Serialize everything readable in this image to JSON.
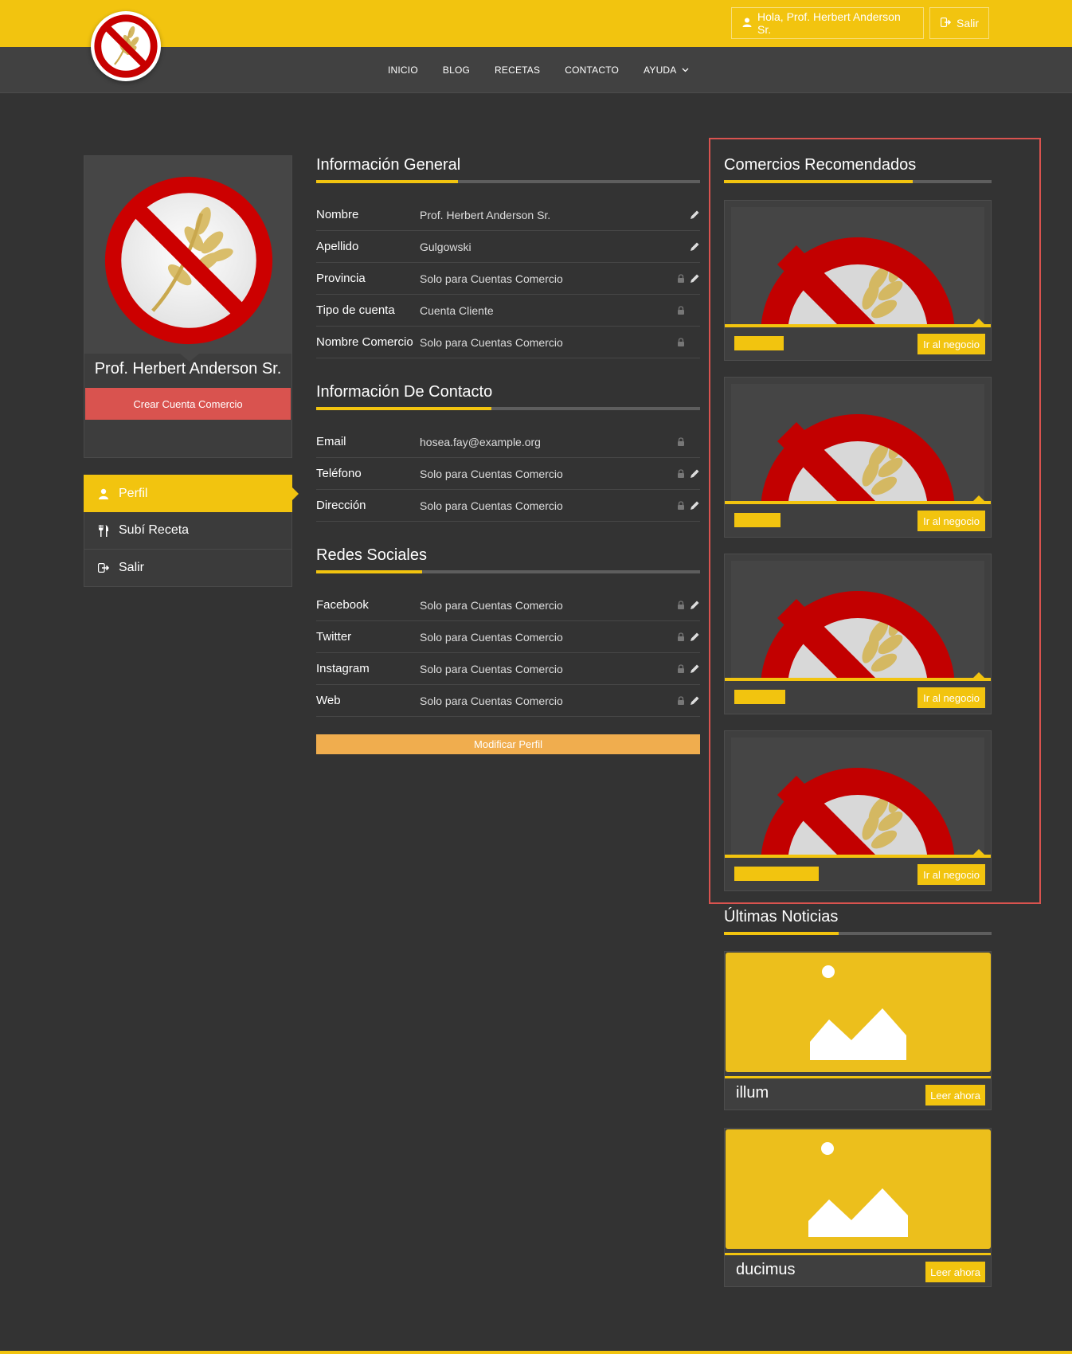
{
  "header": {
    "greeting": "Hola, Prof. Herbert Anderson Sr.",
    "logout": "Salir"
  },
  "nav": {
    "items": [
      "INICIO",
      "BLOG",
      "RECETAS",
      "CONTACTO",
      "AYUDA"
    ]
  },
  "profile": {
    "name": "Prof. Herbert Anderson Sr.",
    "create_button": "Crear Cuenta Comercio"
  },
  "side_menu": {
    "items": [
      {
        "label": "Perfil",
        "icon": "user-icon"
      },
      {
        "label": "Subí Receta",
        "icon": "cutlery-icon"
      },
      {
        "label": "Salir",
        "icon": "logout-icon"
      }
    ]
  },
  "general": {
    "title": "Información General",
    "rows": [
      {
        "label": "Nombre",
        "value": "Prof. Herbert Anderson Sr."
      },
      {
        "label": "Apellido",
        "value": "Gulgowski"
      },
      {
        "label": "Provincia",
        "value": "Solo para Cuentas Comercio"
      },
      {
        "label": "Tipo de cuenta",
        "value": "Cuenta Cliente"
      },
      {
        "label": "Nombre Comercio",
        "value": "Solo para Cuentas Comercio"
      }
    ]
  },
  "contact": {
    "title": "Información De Contacto",
    "rows": [
      {
        "label": "Email",
        "value": "hosea.fay@example.org"
      },
      {
        "label": "Teléfono",
        "value": "Solo para Cuentas Comercio"
      },
      {
        "label": "Dirección",
        "value": "Solo para Cuentas Comercio"
      }
    ]
  },
  "social": {
    "title": "Redes Sociales",
    "rows": [
      {
        "label": "Facebook",
        "value": "Solo para Cuentas Comercio"
      },
      {
        "label": "Twitter",
        "value": "Solo para Cuentas Comercio"
      },
      {
        "label": "Instagram",
        "value": "Solo para Cuentas Comercio"
      },
      {
        "label": "Web",
        "value": "Solo para Cuentas Comercio"
      }
    ]
  },
  "modify_button": "Modificar Perfil",
  "recommended": {
    "title": "Comercios Recomendados",
    "button": "Ir al negocio"
  },
  "news": {
    "title": "Últimas Noticias",
    "button": "Leer ahora",
    "items": [
      "illum",
      "ducimus"
    ]
  },
  "colors": {
    "accent": "#f2c40f",
    "danger": "#d9534f",
    "warning": "#f0ad4e",
    "background": "#333333"
  }
}
